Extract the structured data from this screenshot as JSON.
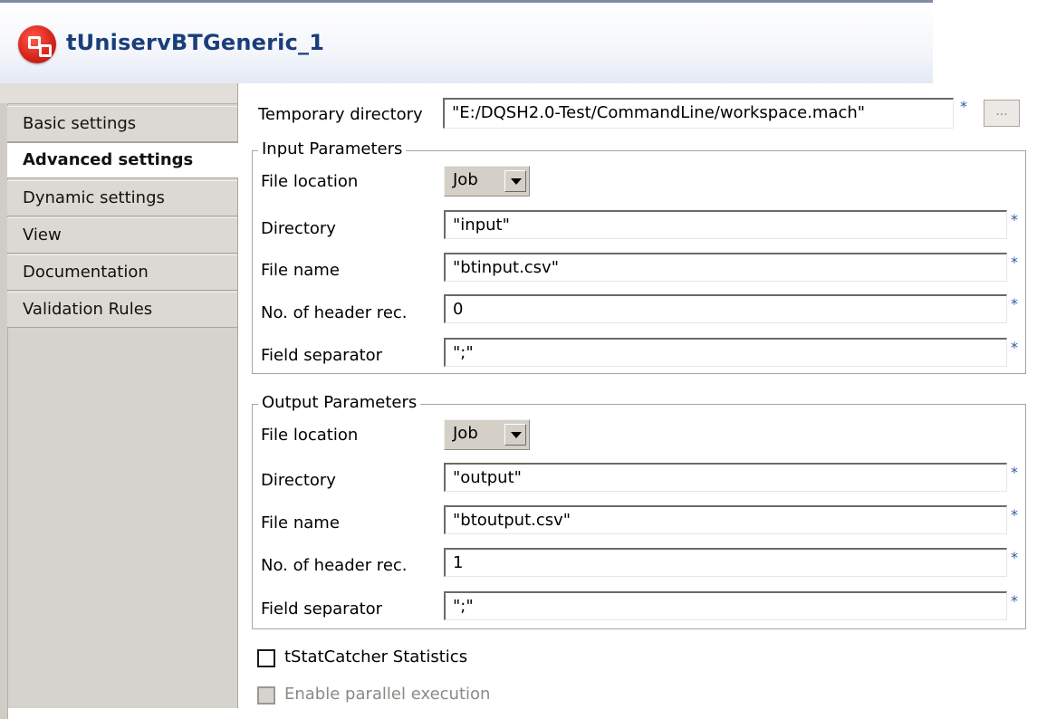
{
  "window": {
    "title": "tUniservBTGeneric_1"
  },
  "tabs": [
    {
      "label": "Basic settings",
      "active": false
    },
    {
      "label": "Advanced settings",
      "active": true
    },
    {
      "label": "Dynamic settings",
      "active": false
    },
    {
      "label": "View",
      "active": false
    },
    {
      "label": "Documentation",
      "active": false
    },
    {
      "label": "Validation Rules",
      "active": false
    }
  ],
  "temp_dir": {
    "label": "Temporary directory",
    "value": "\"E:/DQSH2.0-Test/CommandLine/workspace.mach\"",
    "required": "*",
    "browse_label": "..."
  },
  "input_params": {
    "legend": "Input Parameters",
    "file_location": {
      "label": "File location",
      "value": "Job"
    },
    "directory": {
      "label": "Directory",
      "value": "\"input\""
    },
    "file_name": {
      "label": "File name",
      "value": "\"btinput.csv\""
    },
    "header_rec": {
      "label": "No. of header rec.",
      "value": "0"
    },
    "field_sep": {
      "label": "Field separator",
      "value": "\";\""
    }
  },
  "output_params": {
    "legend": "Output Parameters",
    "file_location": {
      "label": "File location",
      "value": "Job"
    },
    "directory": {
      "label": "Directory",
      "value": "\"output\""
    },
    "file_name": {
      "label": "File name",
      "value": "\"btoutput.csv\""
    },
    "header_rec": {
      "label": "No. of header rec.",
      "value": "1"
    },
    "field_sep": {
      "label": "Field separator",
      "value": "\";\""
    }
  },
  "required_marker": "*",
  "checkboxes": {
    "stat_catcher": {
      "label": "tStatCatcher Statistics",
      "checked": false,
      "enabled": true
    },
    "parallel": {
      "label": "Enable parallel execution",
      "checked": false,
      "enabled": false
    }
  },
  "colors": {
    "title_text": "#1a3e7a",
    "required_star": "#2d5aa8",
    "panel_bg": "#d6d3ce"
  }
}
